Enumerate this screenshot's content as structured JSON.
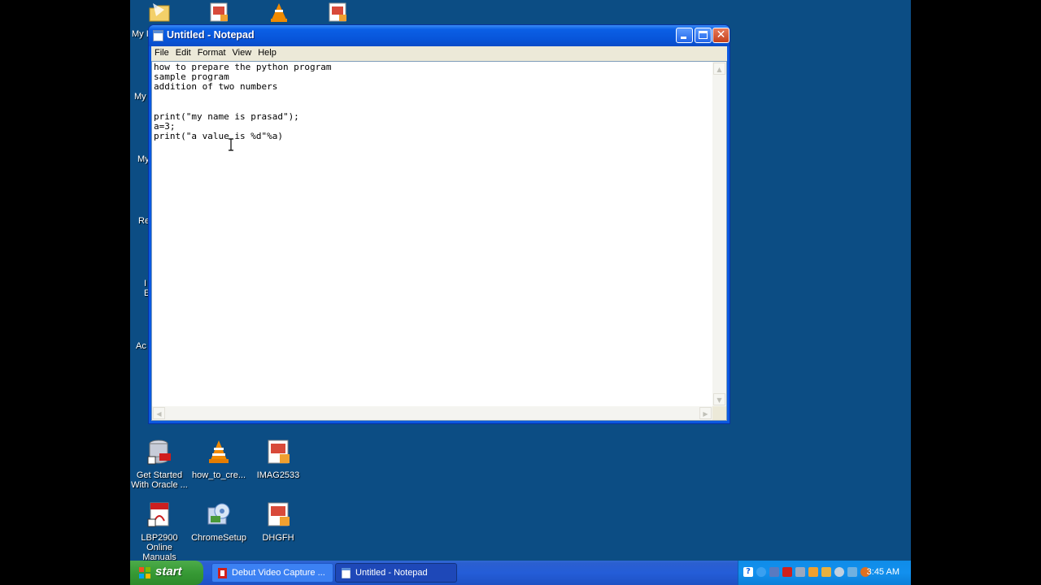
{
  "desktop": {
    "left_labels": [
      "My I",
      "My",
      "My",
      "Re",
      "I",
      "E",
      "Ac"
    ],
    "icons": [
      {
        "label": "Get Started With Oracle ...",
        "icon": "oracle-database-icon"
      },
      {
        "label": "how_to_cre...",
        "icon": "vlc-cone-icon"
      },
      {
        "label": "IMAG2533",
        "icon": "image-file-icon"
      },
      {
        "label": "LBP2900 Online Manuals",
        "icon": "pdf-file-icon"
      },
      {
        "label": "ChromeSetup",
        "icon": "setup-disc-icon"
      },
      {
        "label": "DHGFH",
        "icon": "image-file-icon"
      }
    ]
  },
  "window": {
    "title": "Untitled - Notepad",
    "menu": [
      "File",
      "Edit",
      "Format",
      "View",
      "Help"
    ],
    "text": "how to prepare the python program\nsample program\naddition of two numbers\n\n\nprint(\"my name is prasad\");\na=3;\nprint(\"a value is %d\"%a)"
  },
  "taskbar": {
    "start_label": "start",
    "tasks": [
      {
        "label": "Debut Video Capture ...",
        "active": false
      },
      {
        "label": "Untitled - Notepad",
        "active": true
      }
    ],
    "clock": "3:45 AM"
  },
  "colors": {
    "desktop": "#0c4d84",
    "titlebar": "#0754d8",
    "start": "#379a35",
    "tray": "#1290ee"
  }
}
